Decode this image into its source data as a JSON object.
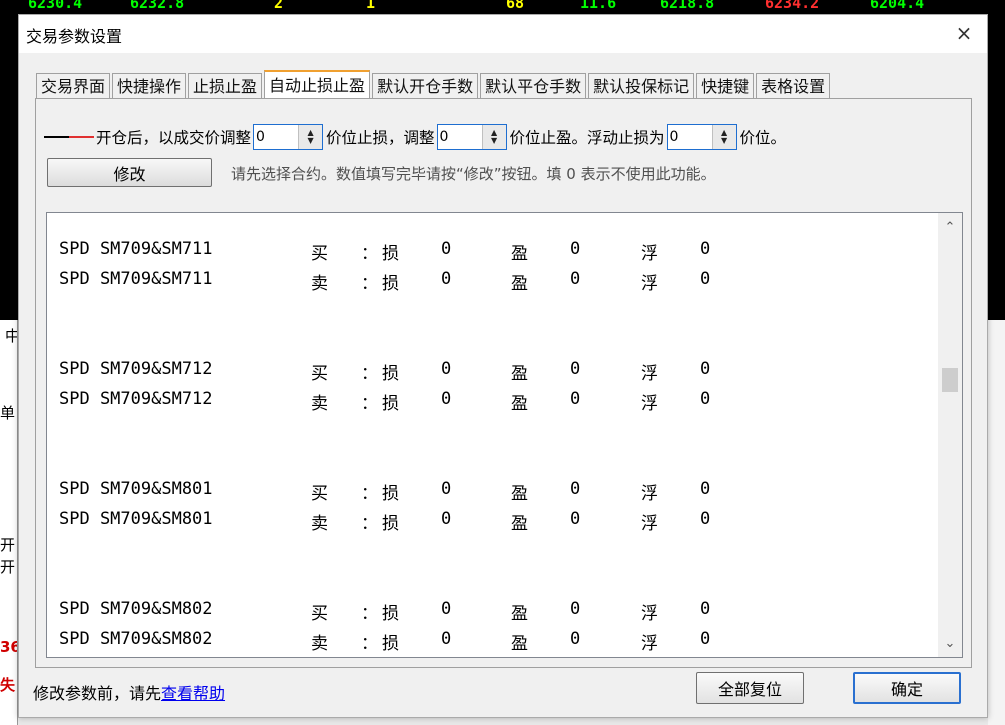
{
  "background": {
    "ticker": [
      {
        "text": "6230.4",
        "color": "#00ff00"
      },
      {
        "text": "6232.8",
        "color": "#00ff00"
      },
      {
        "text": "2",
        "color": "#ffff00"
      },
      {
        "text": "1",
        "color": "#ffff00"
      },
      {
        "text": "68",
        "color": "#ffff00"
      },
      {
        "text": "11.6",
        "color": "#00ff00"
      },
      {
        "text": "6218.8",
        "color": "#00ff00"
      },
      {
        "text": "6234.2",
        "color": "#ff3030"
      },
      {
        "text": "6204.4",
        "color": "#00ff00"
      }
    ],
    "left_fragments": [
      "中",
      "单",
      "开",
      "开",
      "36",
      "失"
    ]
  },
  "dialog": {
    "title": "交易参数设置",
    "close_icon": "×"
  },
  "tabs": [
    {
      "label": "交易界面",
      "active": false
    },
    {
      "label": "快捷操作",
      "active": false
    },
    {
      "label": "止损止盈",
      "active": false
    },
    {
      "label": "自动止损止盈",
      "active": true
    },
    {
      "label": "默认开仓手数",
      "active": false
    },
    {
      "label": "默认平仓手数",
      "active": false
    },
    {
      "label": "默认投保标记",
      "active": false
    },
    {
      "label": "快捷键",
      "active": false
    },
    {
      "label": "表格设置",
      "active": false
    }
  ],
  "config": {
    "prefix": "开仓后，以成交价调整",
    "loss_value": "0",
    "loss_suffix": "价位止损，调整",
    "profit_value": "0",
    "profit_suffix": "价位止盈。浮动止损为",
    "float_value": "0",
    "float_suffix": "价位。",
    "modify_label": "修改",
    "hint": "请先选择合约。数值填写完毕请按“修改”按钮。填 0 表示不使用此功能。"
  },
  "list": {
    "labels": {
      "colon": "：",
      "loss": "损",
      "profit": "盈",
      "float": "浮"
    },
    "rows": [
      {
        "contract": "SPD SM709&SM711",
        "direction": "买",
        "loss": "0",
        "profit": "0",
        "float": "0"
      },
      {
        "contract": "SPD SM709&SM711",
        "direction": "卖",
        "loss": "0",
        "profit": "0",
        "float": "0"
      },
      {
        "contract": "SPD SM709&SM712",
        "direction": "买",
        "loss": "0",
        "profit": "0",
        "float": "0"
      },
      {
        "contract": "SPD SM709&SM712",
        "direction": "卖",
        "loss": "0",
        "profit": "0",
        "float": "0"
      },
      {
        "contract": "SPD SM709&SM801",
        "direction": "买",
        "loss": "0",
        "profit": "0",
        "float": "0"
      },
      {
        "contract": "SPD SM709&SM801",
        "direction": "卖",
        "loss": "0",
        "profit": "0",
        "float": "0"
      },
      {
        "contract": "SPD SM709&SM802",
        "direction": "买",
        "loss": "0",
        "profit": "0",
        "float": "0"
      },
      {
        "contract": "SPD SM709&SM802",
        "direction": "卖",
        "loss": "0",
        "profit": "0",
        "float": "0"
      }
    ]
  },
  "footer": {
    "note_prefix": "修改参数前，请先",
    "help_link": "查看帮助",
    "reset_label": "全部复位",
    "ok_label": "确定"
  }
}
